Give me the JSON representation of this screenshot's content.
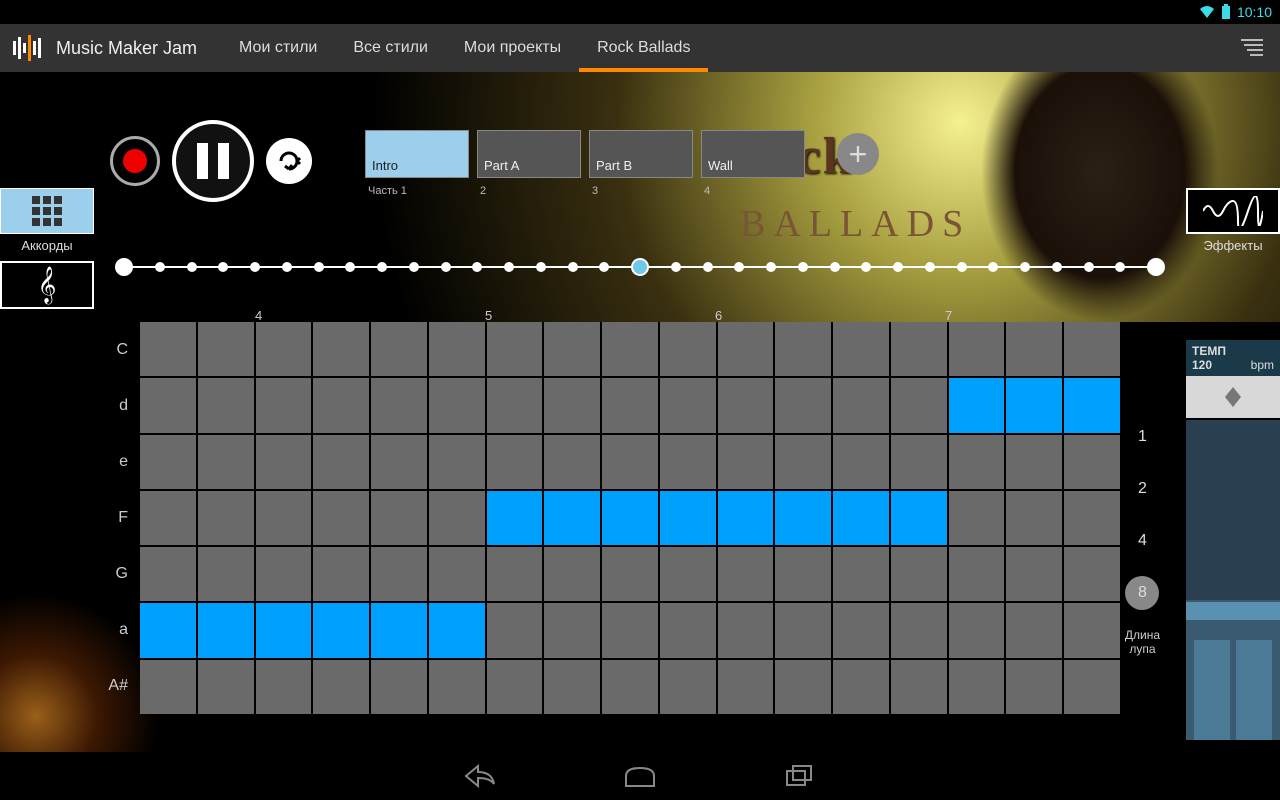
{
  "status": {
    "time": "10:10"
  },
  "appbar": {
    "title": "Music Maker Jam",
    "tabs": [
      "Мои стили",
      "Все стили",
      "Мои проекты",
      "Rock Ballads"
    ],
    "active_tab": 3
  },
  "banner": {
    "title": "Rock",
    "subtitle": "BALLADS"
  },
  "left_panel": {
    "chords_label": "Аккорды"
  },
  "right_panel": {
    "effects_label": "Эффекты"
  },
  "parts": {
    "items": [
      {
        "label": "Intro",
        "sublabel": "Часть 1",
        "active": true
      },
      {
        "label": "Part A",
        "sublabel": "2",
        "active": false
      },
      {
        "label": "Part B",
        "sublabel": "3",
        "active": false
      },
      {
        "label": "Wall",
        "sublabel": "4",
        "active": false
      }
    ]
  },
  "timeline": {
    "dots": 33,
    "current_index": 16
  },
  "grid": {
    "note_labels": [
      "C",
      "d",
      "e",
      "F",
      "G",
      "a",
      "A#"
    ],
    "beat_labels": [
      "4",
      "5",
      "6",
      "7"
    ],
    "beat_positions": [
      115,
      345,
      575,
      805
    ],
    "rows": 7,
    "cols": 17,
    "selected": [
      [
        1,
        14
      ],
      [
        1,
        15
      ],
      [
        1,
        16
      ],
      [
        3,
        6
      ],
      [
        3,
        7
      ],
      [
        3,
        8
      ],
      [
        3,
        9
      ],
      [
        3,
        10
      ],
      [
        3,
        11
      ],
      [
        3,
        12
      ],
      [
        3,
        13
      ],
      [
        5,
        0
      ],
      [
        5,
        1
      ],
      [
        5,
        2
      ],
      [
        5,
        3
      ],
      [
        5,
        4
      ],
      [
        5,
        5
      ]
    ]
  },
  "loop_length": {
    "options": [
      "1",
      "2",
      "4",
      "8"
    ],
    "active": "8",
    "label": "Длина\nлупа"
  },
  "tempo": {
    "label": "ТЕМП",
    "value": "120",
    "unit": "bpm"
  }
}
